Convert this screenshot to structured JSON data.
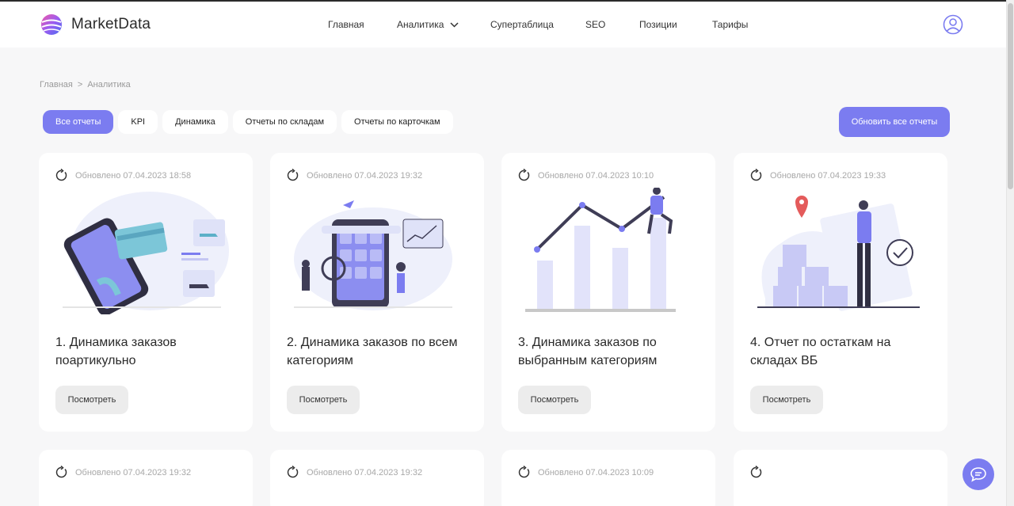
{
  "header": {
    "brand": "MarketData",
    "nav": [
      {
        "label": "Главная"
      },
      {
        "label": "Аналитика"
      },
      {
        "label": "Супертаблица"
      },
      {
        "label": "SEO"
      },
      {
        "label": "Позиции"
      },
      {
        "label": "Тарифы"
      }
    ]
  },
  "breadcrumb": {
    "home": "Главная",
    "separator": ">",
    "current": "Аналитика"
  },
  "filters": [
    "Все отчеты",
    "KPI",
    "Динамика",
    "Отчеты по складам",
    "Отчеты по карточкам"
  ],
  "active_filter": "Все отчеты",
  "refresh_all_label": "Обновить все отчеты",
  "cards": [
    {
      "updated": "Обновлено 07.04.2023 18:58",
      "title": "1. Динамика заказов поартикульно",
      "button": "Посмотреть"
    },
    {
      "updated": "Обновлено 07.04.2023 19:32",
      "title": "2. Динамика заказов по всем категориям",
      "button": "Посмотреть"
    },
    {
      "updated": "Обновлено 07.04.2023 10:10",
      "title": "3. Динамика заказов по выбранным категориям",
      "button": "Посмотреть"
    },
    {
      "updated": "Обновлено 07.04.2023 19:33",
      "title": "4. Отчет по остаткам на складах ВБ",
      "button": "Посмотреть"
    },
    {
      "updated": "Обновлено 07.04.2023 19:32"
    },
    {
      "updated": "Обновлено 07.04.2023 19:32"
    },
    {
      "updated": "Обновлено 07.04.2023 10:09"
    },
    {
      "updated": ""
    }
  ],
  "colors": {
    "accent": "#7b7cf0",
    "background": "#f7f7f8",
    "card": "#ffffff"
  },
  "icons": [
    "logo-icon",
    "chevron-down-icon",
    "user-icon",
    "refresh-icon",
    "chat-icon"
  ]
}
